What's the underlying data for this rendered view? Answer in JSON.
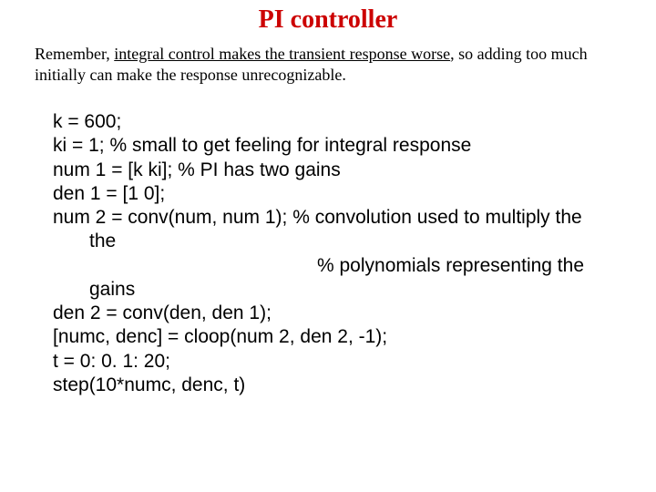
{
  "title": "PI controller",
  "intro": {
    "p1a": "Remember, ",
    "p1b": "integral control makes the transient response worse",
    "p1c": ", so adding too much initially can make the response unrecognizable."
  },
  "code": {
    "l1": "k = 600;",
    "l2": "ki = 1; % small to get feeling for integral response",
    "l3": "num 1 = [k ki]; % PI has two gains",
    "l4": "den 1 = [1 0];",
    "l5": "num 2 = conv(num, num 1); % convolution used to multiply the",
    "l6": "% polynomials representing the gains",
    "l7": "den 2 = conv(den, den 1);",
    "l8": "[numc, denc] = cloop(num 2, den 2, -1);",
    "l9": "t = 0: 0. 1: 20;",
    "l10": "step(10*numc, denc, t)"
  }
}
